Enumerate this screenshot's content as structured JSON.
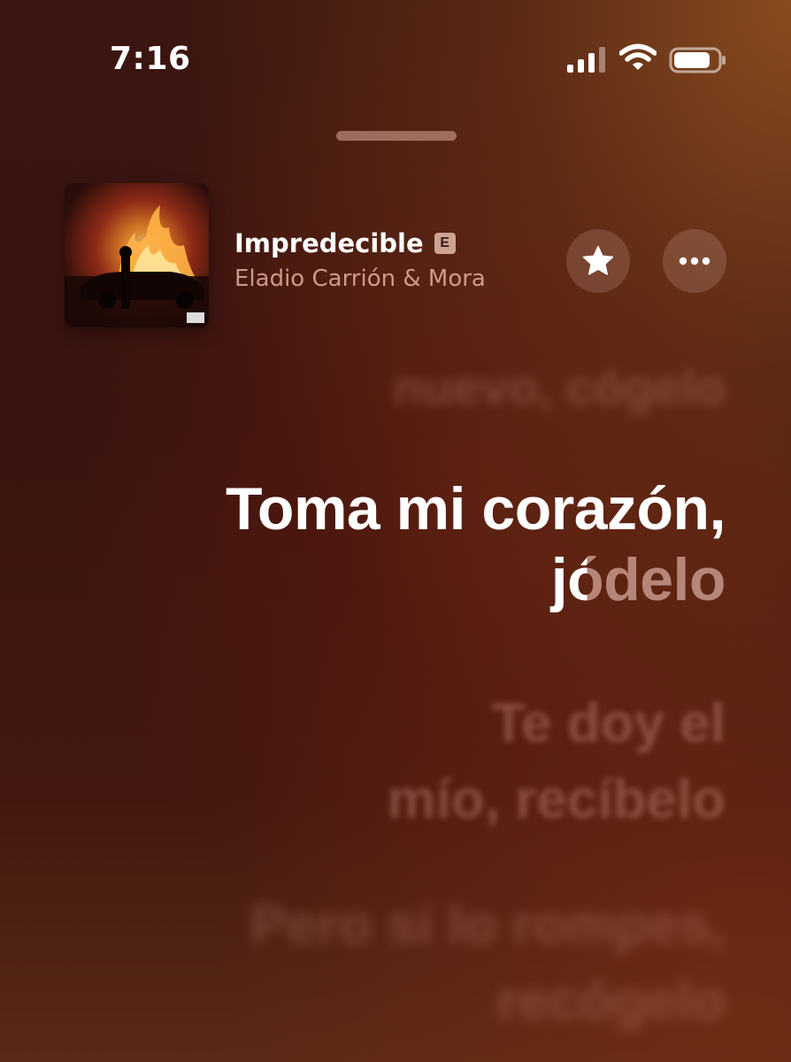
{
  "status_bar": {
    "time": "7:16",
    "icons": [
      "cellular-signal-icon",
      "wifi-icon",
      "battery-icon"
    ]
  },
  "now_playing": {
    "title": "Impredecible",
    "explicit_badge": "E",
    "artist": "Eladio Carrión & Mora",
    "artwork": "album-artwork",
    "favorite_icon": "star-icon",
    "more_icon": "ellipsis-icon"
  },
  "lyrics": {
    "previous_line": "nuevo, cógelo",
    "current_line": {
      "line1": "Toma mi corazón,",
      "line2_sung": "j",
      "line2_partial": "ó",
      "line2_unsung": "delo"
    },
    "next_line": {
      "line1": "Te doy el",
      "line2": "mío, recíbelo"
    },
    "following_line": {
      "line1": "Pero si lo rompes,",
      "line2": "recógelo"
    }
  },
  "colors": {
    "background_top": "#3b1610",
    "background_glow": "#96551f",
    "lyric_active": "#ffffff",
    "lyric_inactive": "#ffd7cd"
  }
}
